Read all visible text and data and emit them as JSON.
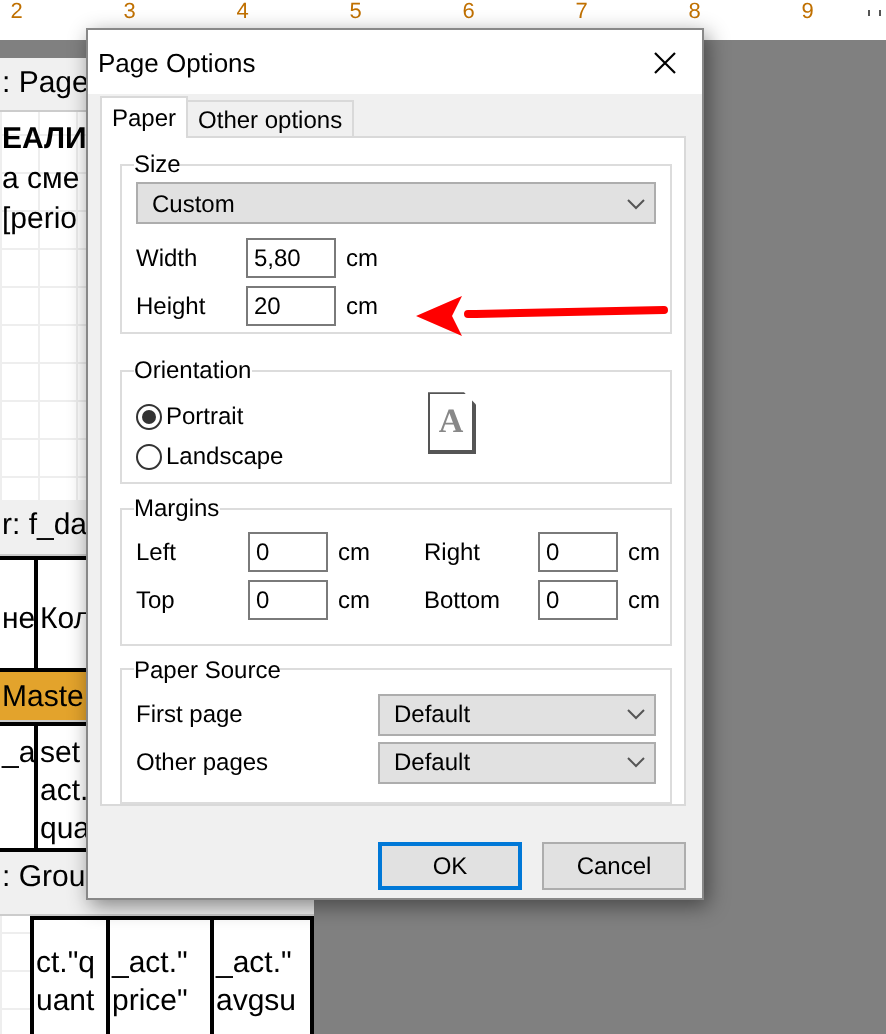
{
  "ruler": {
    "labels": [
      "2",
      "3",
      "4",
      "5",
      "6",
      "7",
      "8",
      "9"
    ]
  },
  "report": {
    "bands": [
      {
        "kind": "page_header",
        "title": ": Page",
        "lines": [
          {
            "text": "ЕАЛИ",
            "bold": true
          },
          {
            "text": "а сме",
            "bold": false
          },
          {
            "text": "[perio",
            "bold": false
          }
        ]
      },
      {
        "kind": "header",
        "title": "r: f_da",
        "cells": [
          {
            "lines": [
              "не"
            ]
          },
          {
            "lines": [
              "Кол"
            ]
          }
        ]
      },
      {
        "kind": "master",
        "title": "Maste",
        "cells": [
          {
            "lines": [
              "_a"
            ]
          },
          {
            "lines": [
              "set",
              "act.",
              "qua"
            ]
          }
        ]
      },
      {
        "kind": "group",
        "title": ": Grou",
        "cells": [
          {
            "lines": [
              "ct.\"q",
              "uant"
            ]
          },
          {
            "lines": [
              "_act.\"",
              "price\""
            ]
          },
          {
            "lines": [
              "_act.\"",
              "avgsu"
            ]
          }
        ]
      }
    ]
  },
  "dialog": {
    "title": "Page Options",
    "tabs": [
      {
        "label": "Paper",
        "selected": true
      },
      {
        "label": "Other options",
        "selected": false
      }
    ],
    "size": {
      "legend": "Size",
      "select": "Custom",
      "fields": [
        {
          "label": "Width",
          "value": "5,80",
          "unit": "cm"
        },
        {
          "label": "Height",
          "value": "20",
          "unit": "cm"
        }
      ]
    },
    "orientation": {
      "legend": "Orientation",
      "options": [
        {
          "label": "Portrait",
          "selected": true
        },
        {
          "label": "Landscape",
          "selected": false
        }
      ],
      "preview_letter": "A"
    },
    "margins": {
      "legend": "Margins",
      "fields": [
        {
          "label": "Left",
          "value": "0",
          "unit": "cm"
        },
        {
          "label": "Right",
          "value": "0",
          "unit": "cm"
        },
        {
          "label": "Top",
          "value": "0",
          "unit": "cm"
        },
        {
          "label": "Bottom",
          "value": "0",
          "unit": "cm"
        }
      ]
    },
    "paper_source": {
      "legend": "Paper Source",
      "selects": [
        {
          "label": "First page",
          "value": "Default"
        },
        {
          "label": "Other pages",
          "value": "Default"
        }
      ]
    },
    "buttons": [
      {
        "label": "OK",
        "default": true
      },
      {
        "label": "Cancel",
        "default": false
      }
    ]
  }
}
